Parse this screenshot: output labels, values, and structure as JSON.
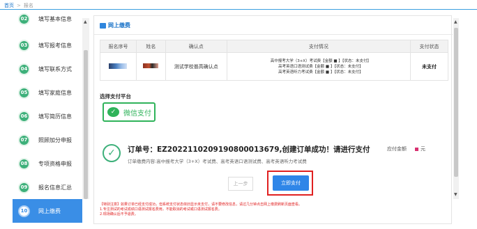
{
  "breadcrumb": {
    "home": "首页",
    "separator": ">",
    "current": "报名"
  },
  "sidebar": {
    "items": [
      {
        "num": "02",
        "label": "填写基本信息",
        "active": false
      },
      {
        "num": "03",
        "label": "填写报考信息",
        "active": false
      },
      {
        "num": "04",
        "label": "填写联系方式",
        "active": false
      },
      {
        "num": "05",
        "label": "填写家庭信息",
        "active": false
      },
      {
        "num": "06",
        "label": "填写简历信息",
        "active": false
      },
      {
        "num": "07",
        "label": "照顾加分申报",
        "active": false
      },
      {
        "num": "08",
        "label": "专项资格申报",
        "active": false
      },
      {
        "num": "09",
        "label": "报名信息汇总",
        "active": false
      },
      {
        "num": "10",
        "label": "网上缴费",
        "active": true
      }
    ]
  },
  "main": {
    "heading": "网上缴费",
    "table": {
      "headers": [
        "报名序号",
        "姓名",
        "确认点",
        "支付情况",
        "支付状态"
      ],
      "row": {
        "confirm_point": "测试学校普高确认点",
        "status_lines": [
          "高中报考大学（3+X）考试费【金额 ■ 】【状态：未支付】",
          "高考英语口语测试费【金额 ■ 】【状态：未支付】",
          "高考英语听力考试费【金额 ■ 】【状态：未支付】"
        ],
        "pay_status": "未支付"
      }
    },
    "platform_title": "选择支付平台",
    "wechat_label": "微信支付",
    "order_title": "订单号：EZ202211020919080001367​9,创建订单成功！请进行支付",
    "order_sub": "订单缴费内容:高中报考大学（3+X）考试费、高考英语口语测试费、高考英语听力考试费",
    "amount_label": "应付金额",
    "amount_unit": "元",
    "prev_button": "上一步",
    "pay_button": "立即支付",
    "notice_lines": [
      "【特别注意】如果订单已经支付成功，但系统支付状态依旧显示未支付，请不要修改信息，请过几分钟点击网上缴费刷新页面查看。",
      "1.专注测试的考试成绩口语测试报名费用，不能取消的考试或口语测试报名费。",
      "2.现场确认后不予退费。"
    ]
  }
}
